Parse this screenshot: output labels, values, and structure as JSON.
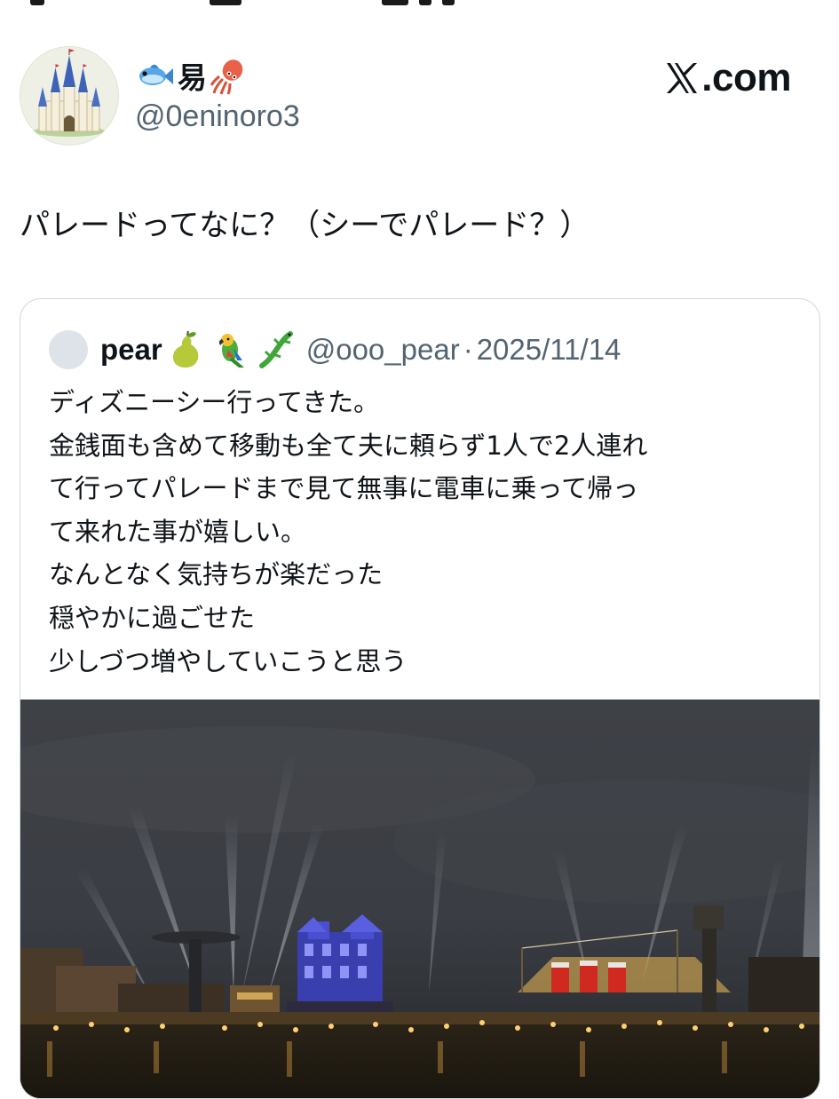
{
  "post": {
    "author": {
      "display_name": "易",
      "name_emoji_left": "fish-emoji",
      "name_emoji_right": "squid-emoji",
      "handle": "@0eninoro3",
      "avatar_icon": "castle-avatar"
    },
    "brand": {
      "logo": "x-logo-icon",
      "text": ".com"
    },
    "text": "パレードってなに？（シーでパレード？）"
  },
  "quote": {
    "author": {
      "display_name": "pear",
      "name_emojis": [
        "pear-emoji",
        "parrot-emoji",
        "lizard-emoji"
      ],
      "handle": "@ooo_pear",
      "separator": "·",
      "date": "2025/11/14"
    },
    "lines": [
      "ディズニーシー行ってきた。",
      "金銭面も含めて移動も全て夫に頼らず1人で2人連れ",
      "て行ってパレードまで見て無事に電車に乗って帰っ",
      "て来れた事が嬉しい。",
      "なんとなく気持ちが楽だった",
      "穏やかに過ごせた",
      "少しづつ増やしていこうと思う"
    ],
    "photo": {
      "subject": "night-harbor-photo"
    }
  },
  "colors": {
    "text_primary": "#0f1419",
    "text_secondary": "#536471",
    "card_border": "#cfd9de"
  }
}
